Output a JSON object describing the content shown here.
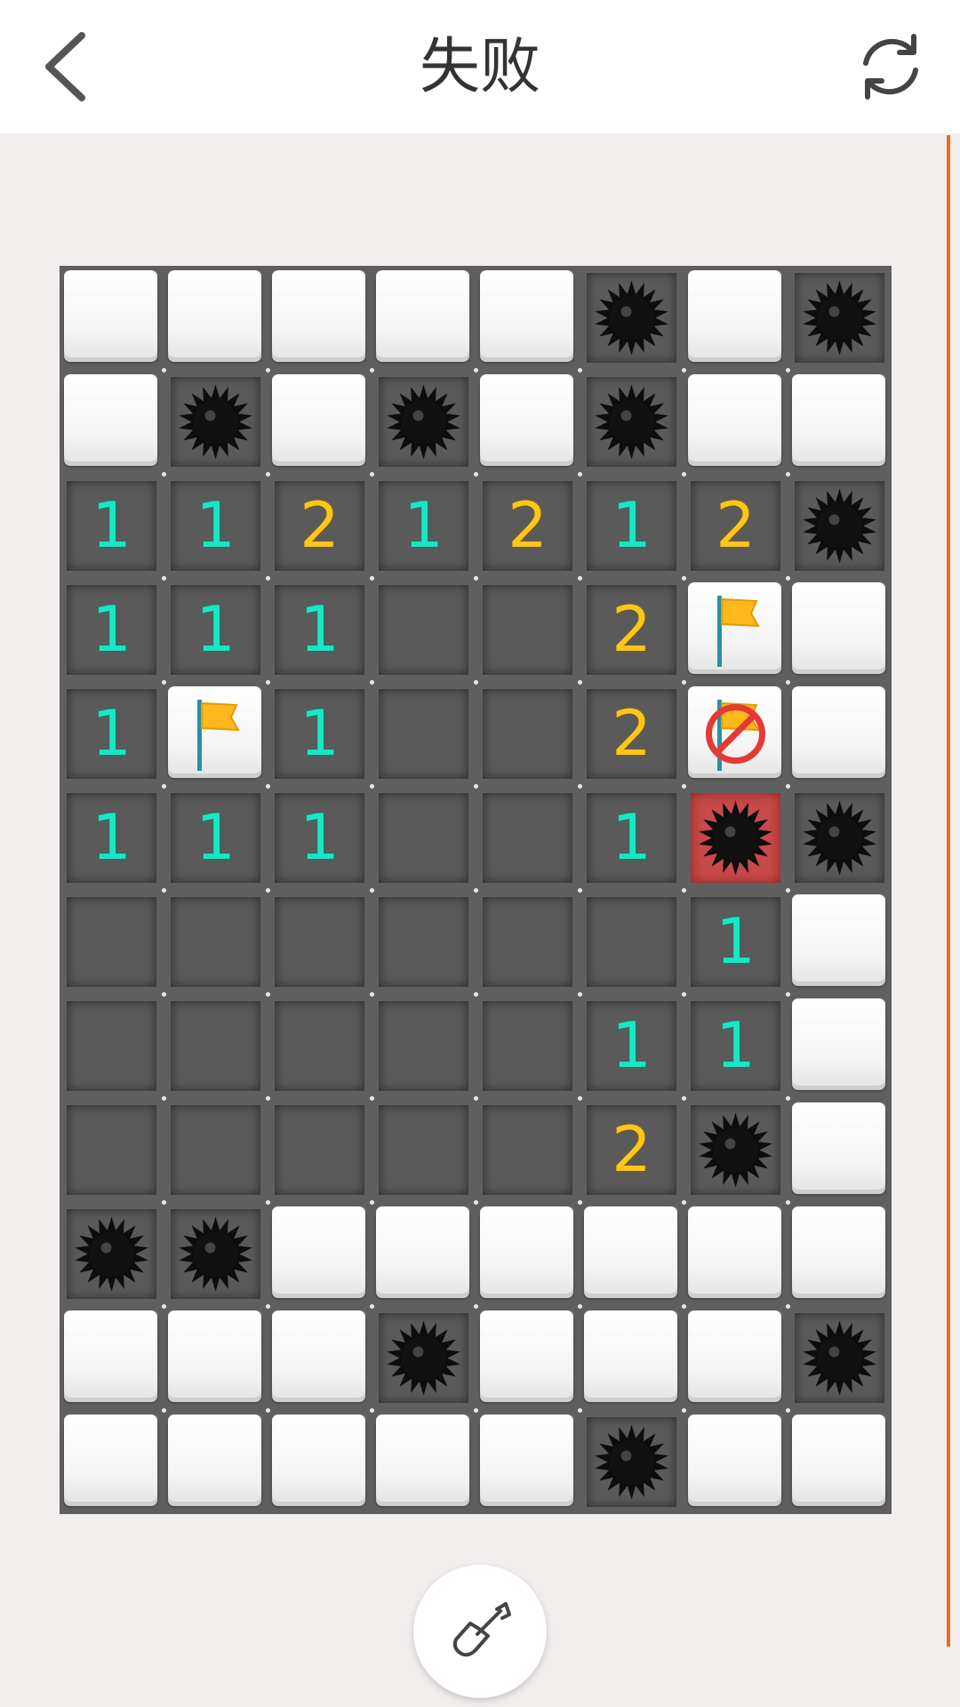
{
  "header": {
    "title": "失败",
    "back_icon": "chevron-left-icon",
    "refresh_icon": "refresh-icon"
  },
  "board": {
    "cols": 8,
    "rows": 12,
    "legend": {
      "H": "hidden",
      "M": "mine",
      "X": "exploded-mine",
      "F": "flag",
      "W": "wrong-flag",
      "0": "empty",
      "1": "one",
      "2": "two"
    },
    "grid": [
      [
        "H",
        "H",
        "H",
        "H",
        "H",
        "M",
        "H",
        "M"
      ],
      [
        "H",
        "M",
        "H",
        "M",
        "H",
        "M",
        "H",
        "H"
      ],
      [
        "1",
        "1",
        "2",
        "1",
        "2",
        "1",
        "2",
        "M"
      ],
      [
        "1",
        "1",
        "1",
        "0",
        "0",
        "2",
        "F",
        "H"
      ],
      [
        "1",
        "F",
        "1",
        "0",
        "0",
        "2",
        "W",
        "H"
      ],
      [
        "1",
        "1",
        "1",
        "0",
        "0",
        "1",
        "X",
        "M"
      ],
      [
        "0",
        "0",
        "0",
        "0",
        "0",
        "0",
        "1",
        "H"
      ],
      [
        "0",
        "0",
        "0",
        "0",
        "0",
        "1",
        "1",
        "H"
      ],
      [
        "0",
        "0",
        "0",
        "0",
        "0",
        "2",
        "M",
        "H"
      ],
      [
        "M",
        "M",
        "H",
        "H",
        "H",
        "H",
        "H",
        "H"
      ],
      [
        "H",
        "H",
        "H",
        "M",
        "H",
        "H",
        "H",
        "M"
      ],
      [
        "H",
        "H",
        "H",
        "H",
        "H",
        "M",
        "H",
        "H"
      ]
    ]
  },
  "colors": {
    "one": "#19e7c3",
    "two": "#ffc61a",
    "exploded": "#c94a4a",
    "accent": "#f26a1b"
  },
  "footer": {
    "dig_icon": "shovel-icon"
  }
}
